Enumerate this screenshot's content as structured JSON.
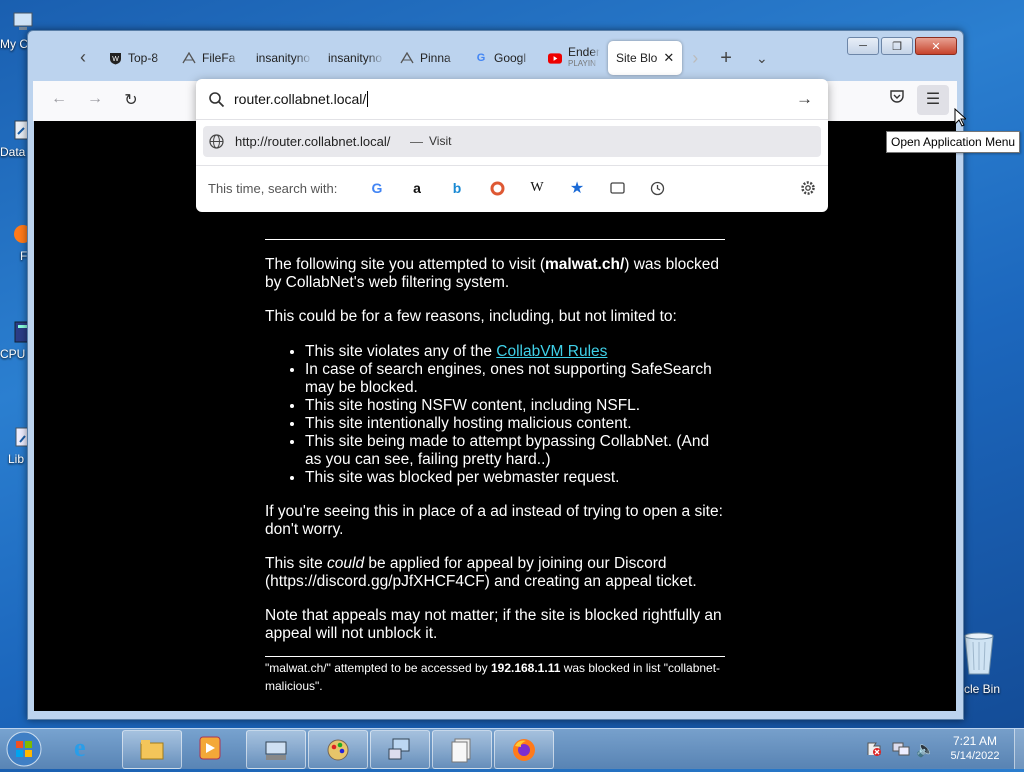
{
  "desktop": {
    "icons": [
      {
        "label": "My C",
        "icon": "computer-icon"
      },
      {
        "label": "Data",
        "icon": "shortcut-icon"
      },
      {
        "label": "F",
        "icon": "firefox-shortcut-icon"
      },
      {
        "label": "CPU",
        "icon": "cpu-icon"
      },
      {
        "label": "Lib",
        "icon": "library-icon"
      },
      {
        "label": "ycle Bin",
        "icon": "recycle-bin-icon"
      }
    ]
  },
  "browser": {
    "tabs": [
      {
        "label": "Top-8",
        "icon": "shield-icon"
      },
      {
        "label": "FileFa",
        "icon": "pinned-icon"
      },
      {
        "label": "insanityno",
        "icon": ""
      },
      {
        "label": "insanityno",
        "icon": ""
      },
      {
        "label": "Pinna",
        "icon": "pinned-icon"
      },
      {
        "label": "Googl",
        "icon": "google-icon"
      },
      {
        "label": "Ender",
        "sublabel": "PLAYIN",
        "icon": "youtube-icon"
      },
      {
        "label": "Site Blo",
        "icon": "",
        "active": true
      }
    ],
    "url_input": "router.collabnet.local/",
    "suggestion": {
      "url": "http://router.collabnet.local/",
      "separator": "—",
      "action": "Visit"
    },
    "search_with_label": "This time, search with:",
    "engines": [
      "google-icon",
      "amazon-icon",
      "bing-icon",
      "duckduckgo-icon",
      "wikipedia-icon",
      "bookmarks-icon",
      "tabs-icon",
      "history-icon"
    ],
    "tooltip": "Open Application Menu"
  },
  "page": {
    "intro_prefix": "The following site you attempted to visit (",
    "blocked_site": "malwat.ch/",
    "intro_suffix": ") was blocked by CollabNet's web filtering system.",
    "reasons_intro": "This could be for a few reasons, including, but not limited to:",
    "reason_1_prefix": "This site violates any of the ",
    "reason_1_link": "CollabVM Rules",
    "reasons": [
      "In case of search engines, ones not supporting SafeSearch may be blocked.",
      "This site hosting NSFW content, including NSFL.",
      "This site intentionally hosting malicious content.",
      "This site being made to attempt bypassing CollabNet. (And as you can see, failing pretty hard..)",
      "This site was blocked per webmaster request."
    ],
    "ad_note": "If you're seeing this in place of a ad instead of trying to open a site: don't worry.",
    "appeal_prefix": "This site ",
    "appeal_em": "could",
    "appeal_suffix": " be applied for appeal by joining our Discord (https://discord.gg/pJfXHCF4CF) and creating an appeal ticket.",
    "appeal_note": "Note that appeals may not matter; if the site is blocked rightfully an appeal will not unblock it.",
    "footer_prefix": "\"malwat.ch/\" attempted to be accessed by ",
    "footer_ip": "192.168.1.11",
    "footer_suffix": " was blocked in list \"collabnet-malicious\"."
  },
  "taskbar": {
    "clock_time": "7:21 AM",
    "clock_date": "5/14/2022"
  }
}
